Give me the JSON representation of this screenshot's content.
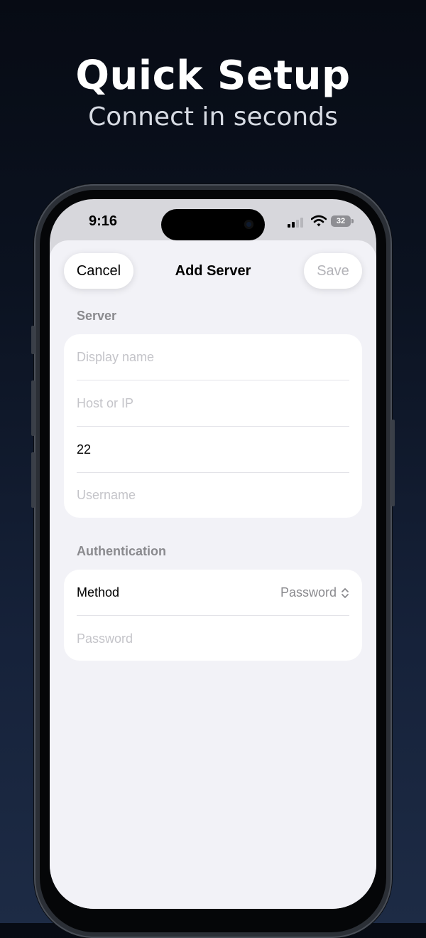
{
  "hero": {
    "title": "Quick Setup",
    "subtitle": "Connect in seconds"
  },
  "status_bar": {
    "time": "9:16",
    "battery": "32",
    "icons": [
      "signal-icon",
      "wifi-icon",
      "battery-icon"
    ]
  },
  "nav": {
    "cancel_label": "Cancel",
    "title": "Add Server",
    "save_label": "Save"
  },
  "server_section": {
    "header": "Server",
    "fields": [
      {
        "placeholder": "Display name",
        "value": ""
      },
      {
        "placeholder": "Host or IP",
        "value": ""
      },
      {
        "placeholder": "",
        "value": "22"
      },
      {
        "placeholder": "Username",
        "value": ""
      }
    ]
  },
  "auth_section": {
    "header": "Authentication",
    "method_label": "Method",
    "method_value": "Password",
    "password_placeholder": "Password"
  },
  "colors": {
    "background": "#0b1220",
    "sheet": "#f2f2f7",
    "group": "#ffffff",
    "secondary_text": "#8a8a8e",
    "placeholder": "#c4c4c9",
    "disabled_save": "#b3b3b8"
  }
}
